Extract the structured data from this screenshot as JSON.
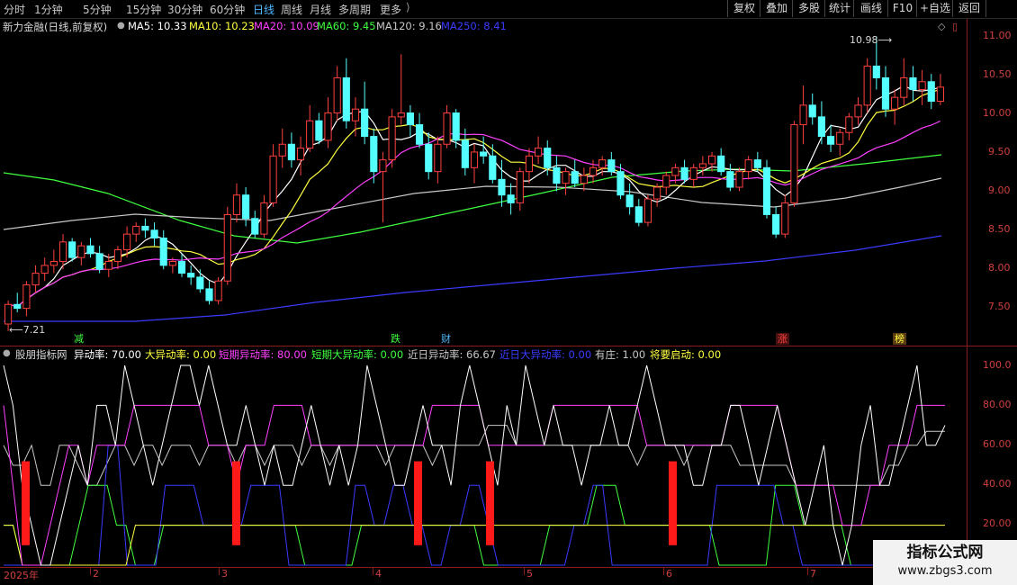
{
  "toolbar": {
    "periods": [
      "分时",
      "1分钟",
      "5分钟",
      "15分钟",
      "30分钟",
      "60分钟",
      "日线",
      "周线",
      "月线",
      "多周期",
      "更多"
    ],
    "active_period": "日线",
    "right_buttons": [
      "复权",
      "叠加",
      "多股",
      "统计",
      "画线",
      "F10",
      "+自选",
      "返回"
    ]
  },
  "main": {
    "title": "新力金融(日线,前复权)",
    "ma": [
      {
        "label": "MA5: 10.33",
        "color": "#ffffff"
      },
      {
        "label": "MA10: 10.23",
        "color": "#ffff40"
      },
      {
        "label": "MA20: 10.09",
        "color": "#ff40ff"
      },
      {
        "label": "MA60: 9.45",
        "color": "#40ff40"
      },
      {
        "label": "MA120: 9.16",
        "color": "#c8c8c8"
      },
      {
        "label": "MA250: 8.41",
        "color": "#3b3bff"
      }
    ],
    "y_ticks": [
      "11.00",
      "10.50",
      "10.00",
      "9.50",
      "9.00",
      "8.50",
      "8.00",
      "7.50"
    ],
    "high_label": "10.98",
    "low_label": "7.21",
    "event_tags": [
      {
        "text": "减",
        "color": "#40ff40"
      },
      {
        "text": "跌",
        "color": "#40ff40"
      },
      {
        "text": "财",
        "color": "#4fb8ff"
      },
      {
        "text": "涨",
        "color": "#ff4040"
      },
      {
        "text": "榜",
        "color": "#ffff40"
      }
    ]
  },
  "indicator": {
    "name": "股朋指标网",
    "values": [
      {
        "label": "异动率: 70.00",
        "color": "#ffffff"
      },
      {
        "label": "大异动率: 0.00",
        "color": "#ffff40"
      },
      {
        "label": "短期异动率: 80.00",
        "color": "#ff40ff"
      },
      {
        "label": "短期大异动率: 0.00",
        "color": "#40ff40"
      },
      {
        "label": "近日异动率: 66.67",
        "color": "#c8c8c8"
      },
      {
        "label": "近日大异动率: 0.00",
        "color": "#3b3bff"
      },
      {
        "label": "有庄: 1.00",
        "color": "#c8c8c8"
      },
      {
        "label": "将要启动: 0.00",
        "color": "#ffff40"
      }
    ],
    "y_ticks": [
      "100.0",
      "80.00",
      "60.00",
      "40.00",
      "20.00"
    ]
  },
  "months": [
    "2025年",
    "2",
    "3",
    "4",
    "5",
    "6",
    "7"
  ],
  "watermark": {
    "line1": "指标公式网",
    "line2": "www.zbgs3.com"
  },
  "chart_data": [
    {
      "type": "candlestick",
      "title": "新力金融(日线,前复权)",
      "ylim": [
        7.3,
        11.1
      ],
      "series_note": "daily OHLC candles, red = up, cyan = down",
      "candles": [
        [
          7.3,
          7.6,
          7.21,
          7.55
        ],
        [
          7.55,
          7.7,
          7.45,
          7.5
        ],
        [
          7.5,
          7.85,
          7.4,
          7.8
        ],
        [
          7.8,
          8.05,
          7.7,
          7.95
        ],
        [
          7.95,
          8.15,
          7.85,
          8.05
        ],
        [
          8.05,
          8.25,
          7.95,
          8.1
        ],
        [
          8.1,
          8.45,
          8.0,
          8.35
        ],
        [
          8.35,
          8.4,
          8.1,
          8.15
        ],
        [
          8.15,
          8.35,
          8.05,
          8.3
        ],
        [
          8.3,
          8.4,
          8.15,
          8.2
        ],
        [
          8.2,
          8.3,
          7.95,
          8.0
        ],
        [
          8.0,
          8.2,
          7.9,
          8.1
        ],
        [
          8.1,
          8.3,
          8.0,
          8.25
        ],
        [
          8.25,
          8.55,
          8.15,
          8.45
        ],
        [
          8.45,
          8.6,
          8.35,
          8.55
        ],
        [
          8.55,
          8.65,
          8.4,
          8.5
        ],
        [
          8.5,
          8.6,
          8.3,
          8.4
        ],
        [
          8.4,
          8.5,
          8.0,
          8.05
        ],
        [
          8.05,
          8.15,
          7.95,
          8.1
        ],
        [
          8.1,
          8.2,
          7.9,
          7.95
        ],
        [
          7.95,
          8.05,
          7.8,
          7.9
        ],
        [
          7.9,
          8.0,
          7.7,
          7.75
        ],
        [
          7.75,
          7.85,
          7.55,
          7.6
        ],
        [
          7.6,
          7.9,
          7.55,
          7.85
        ],
        [
          7.85,
          8.8,
          7.8,
          8.7
        ],
        [
          8.7,
          9.1,
          8.6,
          8.95
        ],
        [
          8.95,
          9.05,
          8.55,
          8.65
        ],
        [
          8.65,
          8.75,
          8.4,
          8.45
        ],
        [
          8.45,
          8.95,
          8.4,
          8.85
        ],
        [
          8.85,
          9.6,
          8.8,
          9.45
        ],
        [
          9.45,
          9.8,
          9.3,
          9.6
        ],
        [
          9.6,
          9.75,
          9.3,
          9.4
        ],
        [
          9.4,
          9.7,
          9.2,
          9.55
        ],
        [
          9.55,
          10.1,
          9.5,
          9.9
        ],
        [
          9.9,
          10.0,
          9.6,
          9.65
        ],
        [
          9.65,
          10.2,
          9.55,
          10.0
        ],
        [
          10.0,
          10.6,
          9.9,
          10.45
        ],
        [
          10.45,
          10.7,
          9.8,
          9.9
        ],
        [
          9.9,
          10.2,
          9.7,
          10.05
        ],
        [
          10.05,
          10.4,
          9.6,
          9.7
        ],
        [
          9.7,
          9.8,
          9.1,
          9.25
        ],
        [
          9.25,
          9.5,
          8.6,
          9.4
        ],
        [
          9.4,
          10.05,
          9.3,
          9.95
        ],
        [
          9.95,
          10.75,
          9.85,
          10.0
        ],
        [
          10.0,
          10.1,
          9.7,
          9.85
        ],
        [
          9.85,
          10.0,
          9.55,
          9.6
        ],
        [
          9.6,
          9.75,
          9.15,
          9.25
        ],
        [
          9.25,
          9.7,
          9.1,
          9.6
        ],
        [
          9.6,
          10.1,
          9.55,
          10.0
        ],
        [
          10.0,
          10.05,
          9.55,
          9.65
        ],
        [
          9.65,
          9.8,
          9.2,
          9.3
        ],
        [
          9.3,
          9.6,
          9.1,
          9.5
        ],
        [
          9.5,
          9.7,
          9.35,
          9.45
        ],
        [
          9.45,
          9.6,
          9.1,
          9.15
        ],
        [
          9.15,
          9.4,
          8.8,
          8.95
        ],
        [
          8.95,
          9.1,
          8.7,
          8.85
        ],
        [
          8.85,
          9.3,
          8.75,
          9.25
        ],
        [
          9.25,
          9.55,
          9.1,
          9.45
        ],
        [
          9.45,
          9.7,
          9.35,
          9.55
        ],
        [
          9.55,
          9.65,
          9.2,
          9.3
        ],
        [
          9.3,
          9.45,
          9.0,
          9.1
        ],
        [
          9.1,
          9.3,
          8.95,
          9.25
        ],
        [
          9.25,
          9.4,
          9.05,
          9.1
        ],
        [
          9.1,
          9.3,
          9.0,
          9.2
        ],
        [
          9.2,
          9.4,
          9.1,
          9.3
        ],
        [
          9.3,
          9.45,
          9.2,
          9.4
        ],
        [
          9.4,
          9.5,
          9.2,
          9.25
        ],
        [
          9.25,
          9.35,
          8.9,
          8.95
        ],
        [
          8.95,
          9.1,
          8.7,
          8.8
        ],
        [
          8.8,
          8.9,
          8.55,
          8.6
        ],
        [
          8.6,
          8.95,
          8.55,
          8.9
        ],
        [
          8.9,
          9.1,
          8.8,
          9.05
        ],
        [
          9.05,
          9.25,
          8.95,
          9.2
        ],
        [
          9.2,
          9.35,
          9.1,
          9.3
        ],
        [
          9.3,
          9.4,
          9.1,
          9.15
        ],
        [
          9.15,
          9.35,
          9.05,
          9.3
        ],
        [
          9.3,
          9.45,
          9.2,
          9.35
        ],
        [
          9.35,
          9.5,
          9.25,
          9.45
        ],
        [
          9.45,
          9.55,
          9.2,
          9.25
        ],
        [
          9.25,
          9.35,
          9.0,
          9.05
        ],
        [
          9.05,
          9.3,
          9.0,
          9.25
        ],
        [
          9.25,
          9.45,
          9.15,
          9.4
        ],
        [
          9.4,
          9.5,
          9.25,
          9.3
        ],
        [
          9.3,
          9.4,
          8.65,
          8.7
        ],
        [
          8.7,
          8.8,
          8.4,
          8.45
        ],
        [
          8.45,
          8.95,
          8.4,
          8.85
        ],
        [
          8.85,
          9.9,
          8.8,
          9.85
        ],
        [
          9.85,
          10.35,
          9.6,
          10.1
        ],
        [
          10.1,
          10.25,
          9.85,
          9.95
        ],
        [
          9.95,
          10.15,
          9.6,
          9.7
        ],
        [
          9.7,
          9.85,
          9.5,
          9.6
        ],
        [
          9.6,
          9.8,
          9.45,
          9.75
        ],
        [
          9.75,
          10.0,
          9.65,
          9.95
        ],
        [
          9.95,
          10.2,
          9.85,
          10.1
        ],
        [
          10.1,
          10.7,
          10.0,
          10.6
        ],
        [
          10.6,
          10.98,
          10.3,
          10.45
        ],
        [
          10.45,
          10.6,
          9.95,
          10.05
        ],
        [
          10.05,
          10.3,
          9.85,
          10.2
        ],
        [
          10.2,
          10.7,
          10.1,
          10.45
        ],
        [
          10.45,
          10.6,
          10.15,
          10.3
        ],
        [
          10.3,
          10.55,
          10.1,
          10.4
        ],
        [
          10.4,
          10.5,
          10.05,
          10.15
        ],
        [
          10.15,
          10.5,
          10.1,
          10.33
        ]
      ]
    },
    {
      "type": "bar",
      "title": "股朋指标网",
      "ylim": [
        0,
        105
      ],
      "series": [
        {
          "name": "有庄",
          "values": [
            40,
            40,
            40,
            40,
            40
          ]
        }
      ]
    }
  ]
}
